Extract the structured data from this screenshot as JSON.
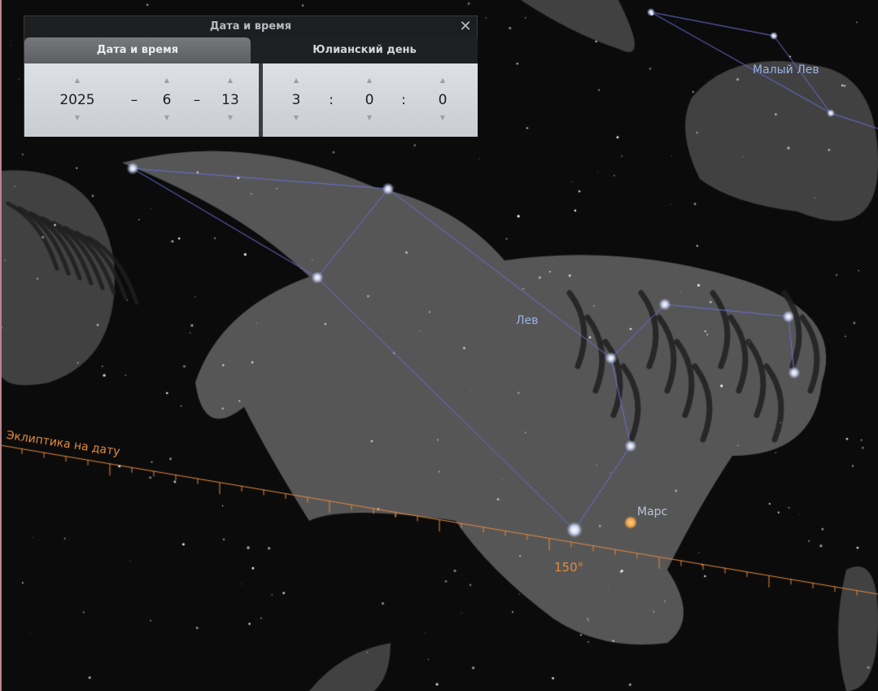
{
  "dialog": {
    "title": "Дата и время",
    "tabs": [
      {
        "label": "Дата и время",
        "active": true
      },
      {
        "label": "Юлианский день",
        "active": false
      }
    ],
    "date": {
      "year": "2025",
      "month": "6",
      "day": "13",
      "separator": "–"
    },
    "time": {
      "hour": "3",
      "minute": "0",
      "second": "0",
      "separator": ":"
    },
    "close_icon": "close-icon",
    "spin_up_icon": "triangle-up-icon",
    "spin_down_icon": "triangle-down-icon"
  },
  "sky": {
    "constellations": [
      "Лев",
      "Малый Лев"
    ],
    "planet": "Марс",
    "ecliptic_label": "Эклиптика на дату",
    "ecliptic_degree": "150°"
  },
  "colors": {
    "background": "#0b0b0c",
    "constellation_lines": "#6d6fd6",
    "constellation_label": "#9bb4e4",
    "ecliptic": "#e58a3a",
    "mars": "#f0a64a"
  }
}
